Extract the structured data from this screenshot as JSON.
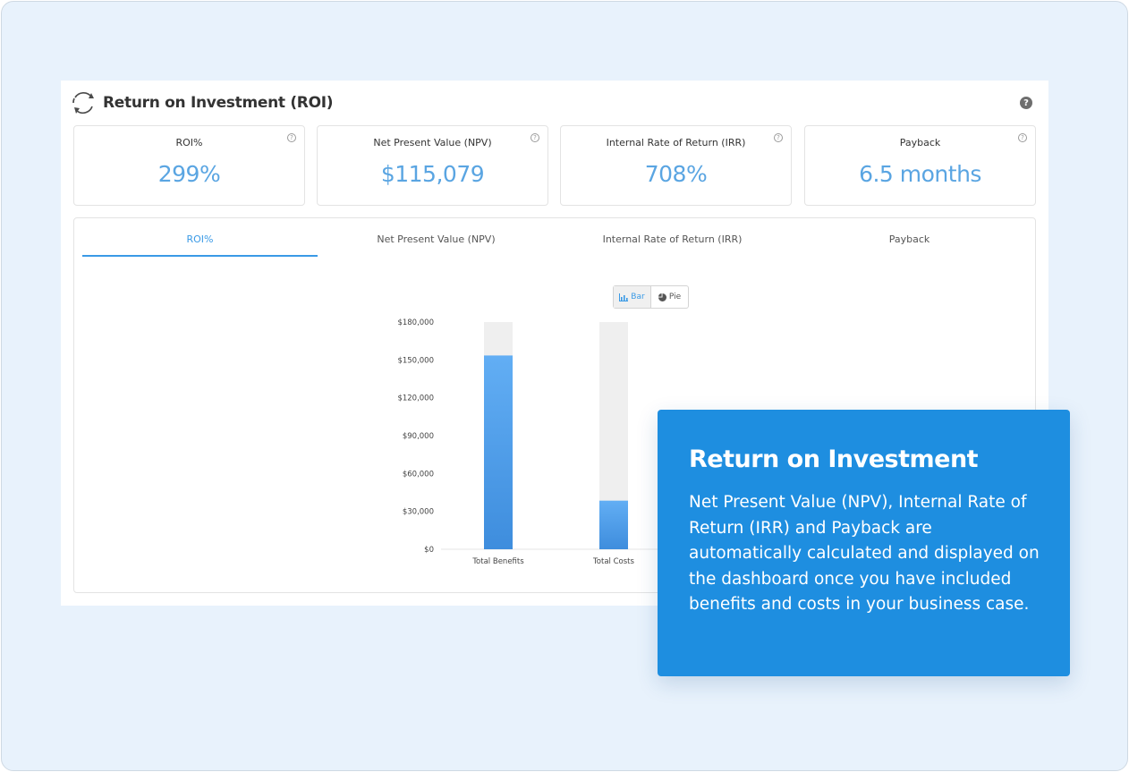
{
  "header": {
    "title": "Return on Investment (ROI)",
    "help": "?"
  },
  "cards": [
    {
      "label": "ROI%",
      "value": "299%"
    },
    {
      "label": "Net Present Value (NPV)",
      "value": "$115,079"
    },
    {
      "label": "Internal Rate of Return (IRR)",
      "value": "708%"
    },
    {
      "label": "Payback",
      "value": "6.5 months"
    }
  ],
  "card_help": "?",
  "tabs": [
    {
      "label": "ROI%",
      "active": true
    },
    {
      "label": "Net Present Value (NPV)",
      "active": false
    },
    {
      "label": "Internal Rate of Return (IRR)",
      "active": false
    },
    {
      "label": "Payback",
      "active": false
    }
  ],
  "toggle": {
    "bar_label": "Bar",
    "pie_label": "Pie",
    "selected": "Bar"
  },
  "icons": {
    "logo": "circular-arrows-icon",
    "help": "question-circle-icon",
    "bar": "bar-chart-icon",
    "pie": "pie-chart-icon"
  },
  "colors": {
    "accent": "#3a9ae6",
    "value": "#5aa5e2",
    "bar_top": "#62aef4",
    "bar_bottom": "#3e8ddd",
    "bar_track": "#efefef",
    "callout_bg": "#1e8ee0",
    "frame_bg": "#e8f2fc"
  },
  "chart_data": {
    "type": "bar",
    "categories": [
      "Total Benefits",
      "Total Costs"
    ],
    "values": [
      153500,
      38500
    ],
    "ylim": [
      0,
      180000
    ],
    "yticks": [
      "$0",
      "$30,000",
      "$60,000",
      "$90,000",
      "$120,000",
      "$150,000",
      "$180,000"
    ],
    "ytick_values": [
      0,
      30000,
      60000,
      90000,
      120000,
      150000,
      180000
    ],
    "grid": false,
    "legend": "none"
  },
  "callout": {
    "title": "Return on Investment",
    "body": "Net Present Value (NPV), Internal Rate of Return (IRR) and Payback are automatically calculated and displayed on the dashboard once you have included benefits and costs in your business case."
  }
}
